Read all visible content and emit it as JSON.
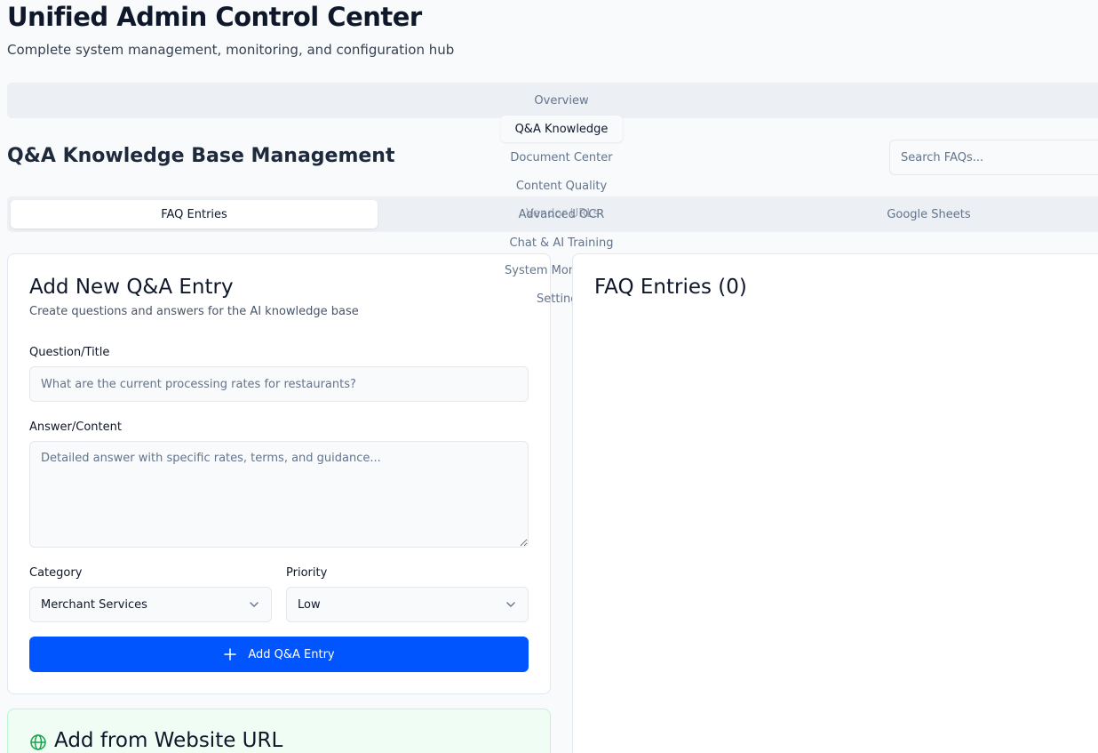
{
  "app": {
    "title": "Unified Admin Control Center",
    "subtitle": "Complete system management, monitoring, and configuration hub"
  },
  "main_nav": {
    "tabs": [
      {
        "label": "Overview",
        "active": false
      },
      {
        "label": "Q&A Knowledge",
        "active": true
      },
      {
        "label": "Document Center",
        "active": false
      },
      {
        "label": "Content Quality",
        "active": false
      },
      {
        "label": "Advanced OCR",
        "active": false
      },
      {
        "label": "Chat & AI Training",
        "active": false
      },
      {
        "label": "System Monitor",
        "active": false
      },
      {
        "label": "Settings",
        "active": false
      }
    ]
  },
  "section": {
    "title": "Q&A Knowledge Base Management",
    "search_placeholder": "Search FAQs..."
  },
  "sub_nav": {
    "tabs": [
      {
        "label": "FAQ Entries",
        "active": true
      },
      {
        "label": "Vendor URLs",
        "active": false
      },
      {
        "label": "Google Sheets",
        "active": false
      }
    ]
  },
  "add_form": {
    "title": "Add New Q&A Entry",
    "description": "Create questions and answers for the AI knowledge base",
    "question_label": "Question/Title",
    "question_placeholder": "What are the current processing rates for restaurants?",
    "answer_label": "Answer/Content",
    "answer_placeholder": "Detailed answer with specific rates, terms, and guidance...",
    "category_label": "Category",
    "category_value": "Merchant Services",
    "priority_label": "Priority",
    "priority_value": "Low",
    "submit_label": "Add Q&A Entry"
  },
  "url_card": {
    "title": "Add from Website URL"
  },
  "faq_list": {
    "title": "FAQ Entries (0)",
    "count": 0
  },
  "colors": {
    "primary": "#0055ff",
    "url_card_bg": "#f0fdf4",
    "globe_icon": "#16a34a"
  }
}
